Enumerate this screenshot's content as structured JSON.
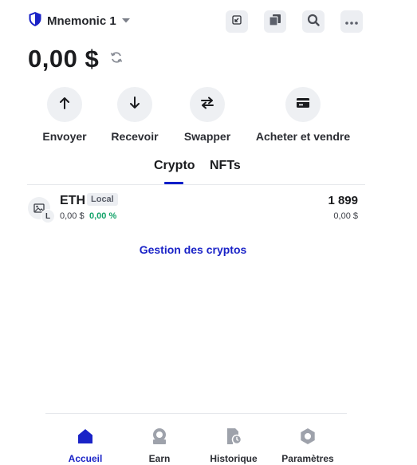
{
  "header": {
    "wallet_name": "Mnemonic 1",
    "icons": [
      "shield-icon",
      "chevron-down-icon",
      "receive-icon",
      "copy-icon",
      "search-icon",
      "more-icon"
    ]
  },
  "balance": {
    "amount": "0,00 $"
  },
  "actions": [
    {
      "label": "Envoyer",
      "icon": "arrow-up-icon"
    },
    {
      "label": "Recevoir",
      "icon": "arrow-down-icon"
    },
    {
      "label": "Swapper",
      "icon": "swap-icon"
    },
    {
      "label": "Acheter et vendre",
      "icon": "card-icon"
    }
  ],
  "tabs": [
    {
      "label": "Crypto",
      "active": true
    },
    {
      "label": "NFTs",
      "active": false
    }
  ],
  "assets": [
    {
      "symbol": "ETH",
      "badge": "L",
      "tag": "Local",
      "fiat_value": "0,00 $",
      "change": "0,00 %",
      "quantity": "1 899",
      "quantity_fiat": "0,00 $"
    }
  ],
  "manage_link": "Gestion des cryptos",
  "nav": [
    {
      "label": "Accueil",
      "icon": "home-icon",
      "active": true
    },
    {
      "label": "Earn",
      "icon": "earn-icon",
      "active": false
    },
    {
      "label": "Historique",
      "icon": "history-icon",
      "active": false
    },
    {
      "label": "Paramètres",
      "icon": "settings-icon",
      "active": false
    }
  ],
  "colors": {
    "accent": "#1a23c7",
    "positive": "#14a36a",
    "icon_muted": "#9ea2ab"
  }
}
